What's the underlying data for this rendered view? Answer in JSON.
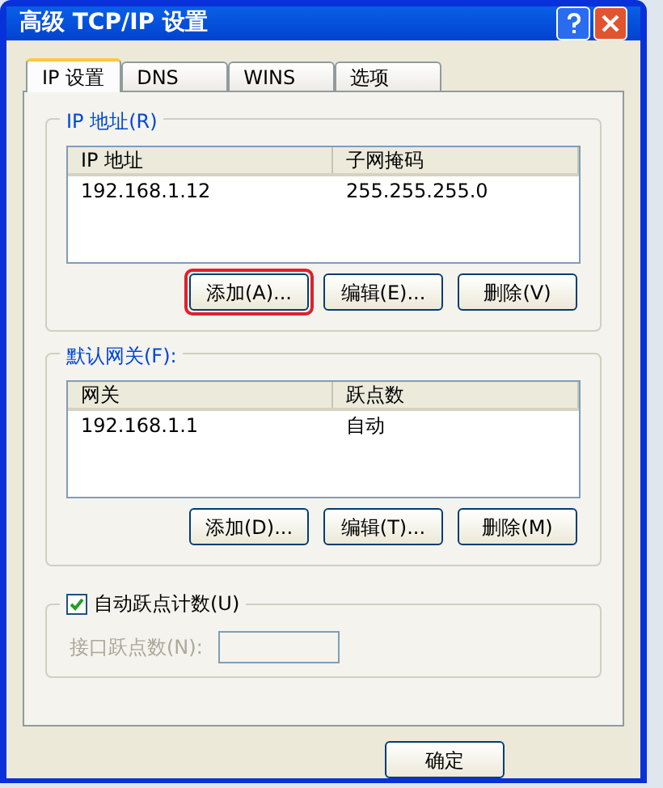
{
  "window": {
    "title": "高级 TCP/IP 设置"
  },
  "tabs": [
    {
      "label": "IP 设置",
      "selected": true
    },
    {
      "label": "DNS",
      "selected": false
    },
    {
      "label": "WINS",
      "selected": false
    },
    {
      "label": "选项",
      "selected": false
    }
  ],
  "ip_group": {
    "title": "IP 地址(R)",
    "columns": [
      "IP 地址",
      "子网掩码"
    ],
    "rows": [
      [
        "192.168.1.12",
        "255.255.255.0"
      ]
    ],
    "buttons": [
      {
        "label": "添加(A)...",
        "highlighted": true
      },
      {
        "label": "编辑(E)...",
        "highlighted": false
      },
      {
        "label": "删除(V)",
        "highlighted": false
      }
    ]
  },
  "gateway_group": {
    "title": "默认网关(F):",
    "columns": [
      "网关",
      "跃点数"
    ],
    "rows": [
      [
        "192.168.1.1",
        "自动"
      ]
    ],
    "buttons": [
      {
        "label": "添加(D)...",
        "highlighted": false
      },
      {
        "label": "编辑(T)...",
        "highlighted": false
      },
      {
        "label": "删除(M)",
        "highlighted": false
      }
    ]
  },
  "metric_group": {
    "checkbox": {
      "label": "自动跃点计数(U)",
      "checked": true
    },
    "field": {
      "label": "接口跃点数(N):",
      "disabled": true
    }
  },
  "footer_buttons": [
    "确定"
  ]
}
